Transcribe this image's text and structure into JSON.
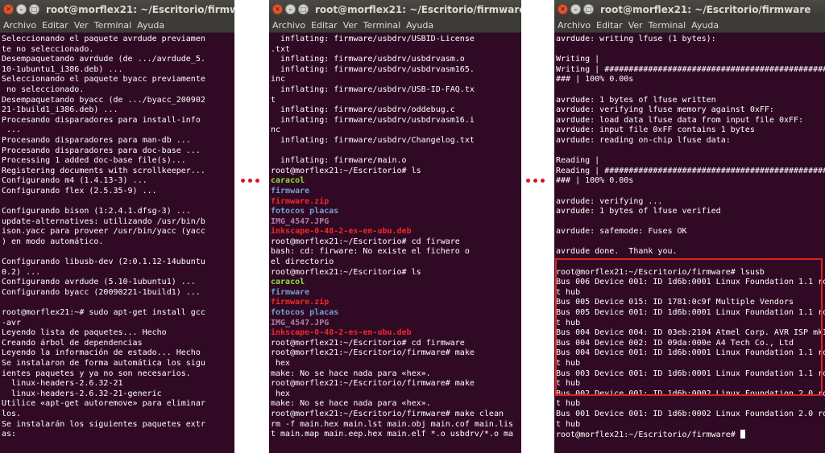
{
  "windows": [
    {
      "title": "root@morflex21: ~/Escritorio/firmware",
      "menu": [
        "Archivo",
        "Editar",
        "Ver",
        "Terminal",
        "Ayuda"
      ],
      "lines": [
        {
          "text": "Seleccionando el paquete avrdude previamen"
        },
        {
          "text": "te no seleccionado."
        },
        {
          "text": "Desempaquetando avrdude (de .../avrdude_5."
        },
        {
          "text": "10-1ubuntu1_i386.deb) ..."
        },
        {
          "text": "Seleccionando el paquete byacc previamente"
        },
        {
          "text": " no seleccionado."
        },
        {
          "text": "Desempaquetando byacc (de .../byacc_200902"
        },
        {
          "text": "21-1build1_i386.deb) ..."
        },
        {
          "text": "Procesando disparadores para install-info"
        },
        {
          "text": " ..."
        },
        {
          "text": "Procesando disparadores para man-db ..."
        },
        {
          "text": "Procesando disparadores para doc-base ..."
        },
        {
          "text": "Processing 1 added doc-base file(s)..."
        },
        {
          "text": "Registering documents with scrollkeeper..."
        },
        {
          "text": "Configurando m4 (1.4.13-3) ..."
        },
        {
          "text": "Configurando flex (2.5.35-9) ..."
        },
        {
          "text": ""
        },
        {
          "text": "Configurando bison (1:2.4.1.dfsg-3) ..."
        },
        {
          "text": "update-alternatives: utilizando /usr/bin/b"
        },
        {
          "text": "ison.yacc para proveer /usr/bin/yacc (yacc"
        },
        {
          "text": ") en modo automático."
        },
        {
          "text": ""
        },
        {
          "text": "Configurando libusb-dev (2:0.1.12-14ubuntu"
        },
        {
          "text": "0.2) ..."
        },
        {
          "text": "Configurando avrdude (5.10-1ubuntu1) ..."
        },
        {
          "text": "Configurando byacc (20090221-1build1) ..."
        },
        {
          "text": ""
        },
        {
          "text": "root@morflex21:~# sudo apt-get install gcc"
        },
        {
          "text": "-avr"
        },
        {
          "text": "Leyendo lista de paquetes... Hecho"
        },
        {
          "text": "Creando árbol de dependencias"
        },
        {
          "text": "Leyendo la información de estado... Hecho"
        },
        {
          "text": "Se instalaron de forma automática los sigu"
        },
        {
          "text": "ientes paquetes y ya no son necesarios."
        },
        {
          "text": "  linux-headers-2.6.32-21"
        },
        {
          "text": "  linux-headers-2.6.32-21-generic"
        },
        {
          "text": "Utilice «apt-get autoremove» para eliminar"
        },
        {
          "text": "los."
        },
        {
          "text": "Se instalarán los siguientes paquetes extr"
        },
        {
          "text": "as:"
        }
      ]
    },
    {
      "title": "root@morflex21: ~/Escritorio/firmware",
      "menu": [
        "Archivo",
        "Editar",
        "Ver",
        "Terminal",
        "Ayuda"
      ],
      "lines": [
        {
          "text": "  inflating: firmware/usbdrv/USBID-License"
        },
        {
          "text": ".txt"
        },
        {
          "text": "  inflating: firmware/usbdrv/usbdrvasm.o"
        },
        {
          "text": "  inflating: firmware/usbdrv/usbdrvasm165."
        },
        {
          "text": "inc"
        },
        {
          "text": "  inflating: firmware/usbdrv/USB-ID-FAQ.tx"
        },
        {
          "text": "t"
        },
        {
          "text": "  inflating: firmware/usbdrv/oddebug.c"
        },
        {
          "text": "  inflating: firmware/usbdrv/usbdrvasm16.i"
        },
        {
          "text": "nc"
        },
        {
          "text": "  inflating: firmware/usbdrv/Changelog.txt"
        },
        {
          "text": ""
        },
        {
          "text": "  inflating: firmware/main.o"
        },
        {
          "text": "root@morflex21:~/Escritorio# ls"
        },
        {
          "text": "caracol",
          "color": "green"
        },
        {
          "text": "firmware",
          "color": "blue"
        },
        {
          "text": "firmware.zip",
          "color": "red"
        },
        {
          "text": "fotocos placas",
          "color": "blue"
        },
        {
          "text": "IMG_4547.JPG",
          "color": "magenta"
        },
        {
          "text": "inkscape-0-48-2-es-en-ubu.deb",
          "color": "red"
        },
        {
          "text": "root@morflex21:~/Escritorio# cd firware"
        },
        {
          "text": "bash: cd: firware: No existe el fichero o"
        },
        {
          "text": "el directorio"
        },
        {
          "text": "root@morflex21:~/Escritorio# ls"
        },
        {
          "text": "caracol",
          "color": "green"
        },
        {
          "text": "firmware",
          "color": "blue"
        },
        {
          "text": "firmware.zip",
          "color": "red"
        },
        {
          "text": "fotocos placas",
          "color": "blue"
        },
        {
          "text": "IMG_4547.JPG",
          "color": "magenta"
        },
        {
          "text": "inkscape-0-48-2-es-en-ubu.deb",
          "color": "red"
        },
        {
          "text": "root@morflex21:~/Escritorio# cd firmware"
        },
        {
          "text": "root@morflex21:~/Escritorio/firmware# make"
        },
        {
          "text": " hex"
        },
        {
          "text": "make: No se hace nada para «hex»."
        },
        {
          "text": "root@morflex21:~/Escritorio/firmware# make"
        },
        {
          "text": " hex"
        },
        {
          "text": "make: No se hace nada para «hex»."
        },
        {
          "text": "root@morflex21:~/Escritorio/firmware# make clean"
        },
        {
          "text": "rm -f main.hex main.lst main.obj main.cof main.lis"
        },
        {
          "text": "t main.map main.eep.hex main.elf *.o usbdrv/*.o ma"
        }
      ]
    },
    {
      "title": "root@morflex21: ~/Escritorio/firmware",
      "menu": [
        "Archivo",
        "Editar",
        "Ver",
        "Terminal",
        "Ayuda"
      ],
      "lines": [
        {
          "text": "avrdude: writing lfuse (1 bytes):"
        },
        {
          "text": ""
        },
        {
          "text": "Writing |"
        },
        {
          "text": "Writing | ################################################"
        },
        {
          "text": "### | 100% 0.00s"
        },
        {
          "text": ""
        },
        {
          "text": "avrdude: 1 bytes of lfuse written"
        },
        {
          "text": "avrdude: verifying lfuse memory against 0xFF:"
        },
        {
          "text": "avrdude: load data lfuse data from input file 0xFF:"
        },
        {
          "text": "avrdude: input file 0xFF contains 1 bytes"
        },
        {
          "text": "avrdude: reading on-chip lfuse data:"
        },
        {
          "text": ""
        },
        {
          "text": "Reading |"
        },
        {
          "text": "Reading | ################################################"
        },
        {
          "text": "### | 100% 0.00s"
        },
        {
          "text": ""
        },
        {
          "text": "avrdude: verifying ..."
        },
        {
          "text": "avrdude: 1 bytes of lfuse verified"
        },
        {
          "text": ""
        },
        {
          "text": "avrdude: safemode: Fuses OK"
        },
        {
          "text": ""
        },
        {
          "text": "avrdude done.  Thank you."
        },
        {
          "text": ""
        },
        {
          "text": "root@morflex21:~/Escritorio/firmware# lsusb"
        },
        {
          "text": "Bus 006 Device 001: ID 1d6b:0001 Linux Foundation 1.1 roo"
        },
        {
          "text": "t hub"
        },
        {
          "text": "Bus 005 Device 015: ID 1781:0c9f Multiple Vendors"
        },
        {
          "text": "Bus 005 Device 001: ID 1d6b:0001 Linux Foundation 1.1 roo"
        },
        {
          "text": "t hub"
        },
        {
          "text": "Bus 004 Device 004: ID 03eb:2104 Atmel Corp. AVR ISP mkII"
        },
        {
          "text": "Bus 004 Device 002: ID 09da:000e A4 Tech Co., Ltd"
        },
        {
          "text": "Bus 004 Device 001: ID 1d6b:0001 Linux Foundation 1.1 roo"
        },
        {
          "text": "t hub"
        },
        {
          "text": "Bus 003 Device 001: ID 1d6b:0001 Linux Foundation 1.1 roo"
        },
        {
          "text": "t hub"
        },
        {
          "text": "Bus 002 Device 001: ID 1d6b:0002 Linux Foundation 2.0 roo"
        },
        {
          "text": "t hub"
        },
        {
          "text": "Bus 001 Device 001: ID 1d6b:0002 Linux Foundation 2.0 roo"
        },
        {
          "text": "t hub"
        },
        {
          "text": "root@morflex21:~/Escritorio/firmware# ",
          "cursor": true
        }
      ]
    }
  ],
  "colors": {
    "terminal_bg": "#300a24",
    "terminal_fg": "#ffffff",
    "green": "#8ae234",
    "blue": "#729fcf",
    "red": "#ef2929",
    "magenta": "#ad7fa8",
    "highlight_border": "#e02020",
    "ellipsis_dots": "#d8141f"
  }
}
